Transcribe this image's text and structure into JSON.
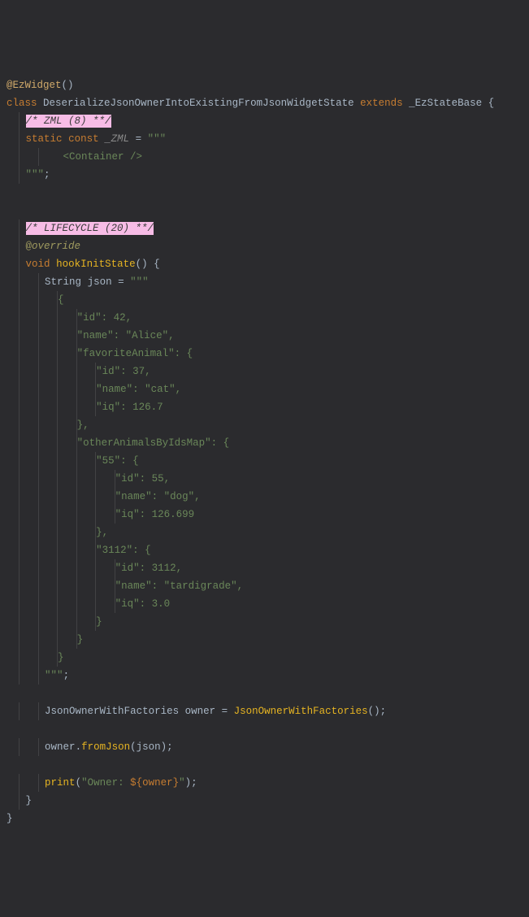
{
  "code": {
    "annotation": "@EzWidget",
    "kw_class": "class",
    "class_name": "DeserializeJsonOwnerIntoExistingFromJsonWidgetState",
    "kw_extends": "extends",
    "base_class": "_EzStateBase",
    "comment_zml": "/* ZML (8) **/",
    "kw_static": "static",
    "kw_const": "const",
    "zml_field": "_ZML",
    "eq": " = ",
    "triple_quote": "\"\"\"",
    "zml_tag": "    <Container />",
    "triple_quote_end": "\"\"\"",
    "semi": ";",
    "comment_lifecycle": "/* LIFECYCLE (20) **/",
    "override": "@override",
    "kw_void": "void",
    "fn_hook": "hookInitState",
    "brace_open": " {",
    "type_string": "String",
    "var_json": "json",
    "json_l1": "    {",
    "json_l2": "        \"id\": 42,",
    "json_l3": "        \"name\": \"Alice\",",
    "json_l4": "        \"favoriteAnimal\": {",
    "json_l5": "            \"id\": 37,",
    "json_l6": "            \"name\": \"cat\",",
    "json_l7": "            \"iq\": 126.7",
    "json_l8": "        },",
    "json_l9": "        \"otherAnimalsByIdsMap\": {",
    "json_l10": "            \"55\": {",
    "json_l11": "                \"id\": 55,",
    "json_l12": "                \"name\": \"dog\",",
    "json_l13": "                \"iq\": 126.699",
    "json_l14": "            },",
    "json_l15": "            \"3112\": {",
    "json_l16": "                \"id\": 3112,",
    "json_l17": "                \"name\": \"tardigrade\",",
    "json_l18": "                \"iq\": 3.0",
    "json_l19": "            }",
    "json_l20": "        }",
    "json_l21": "    }",
    "type_owner": "JsonOwnerWithFactories",
    "var_owner": "owner",
    "ctor_owner": "JsonOwnerWithFactories",
    "from_json": "fromJson",
    "print": "print",
    "print_str1": "\"Owner: ",
    "print_interp": "${owner}",
    "print_str2": "\"",
    "brace_close": "}"
  }
}
